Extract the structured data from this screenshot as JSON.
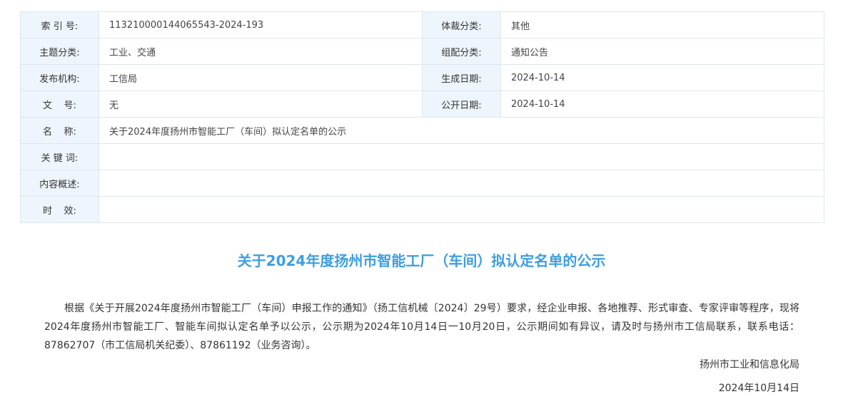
{
  "meta": {
    "index_label": "索 引 号:",
    "index_value": "113210000144065543-2024-193",
    "genre_label": "体裁分类:",
    "genre_value": "其他",
    "topic_label": "主题分类:",
    "topic_value": "工业、交通",
    "assign_label": "组配分类:",
    "assign_value": "通知公告",
    "publisher_label": "发布机构:",
    "publisher_value": "工信局",
    "created_label": "生成日期:",
    "created_value": "2024-10-14",
    "docno_label": "文    号:",
    "docno_value": "无",
    "public_label": "公开日期:",
    "public_value": "2024-10-14",
    "name_label": "名    称:",
    "name_value": "关于2024年度扬州市智能工厂（车间）拟认定名单的公示",
    "keywords_label": "关 键 词:",
    "keywords_value": "",
    "summary_label": "内容概述:",
    "summary_value": "",
    "validity_label": "时    效:",
    "validity_value": ""
  },
  "article": {
    "title": "关于2024年度扬州市智能工厂（车间）拟认定名单的公示",
    "body": "根据《关于开展2024年度扬州市智能工厂（车间）申报工作的通知》（扬工信机械〔2024〕29号）要求，经企业申报、各地推荐、形式审查、专家评审等程序，现将2024年度扬州市智能工厂、智能车间拟认定名单予以公示，公示期为2024年10月14日一10月20日，公示期间如有异议，请及时与扬州市工信局联系，联系电话：87862707（市工信局机关纪委）、87861192（业务咨询）。",
    "signature": "扬州市工业和信息化局",
    "date": "2024年10月14日"
  },
  "colors": {
    "title": "#3d9ee0",
    "label_bg": "#eef5fc",
    "border": "#dfe6ee"
  }
}
